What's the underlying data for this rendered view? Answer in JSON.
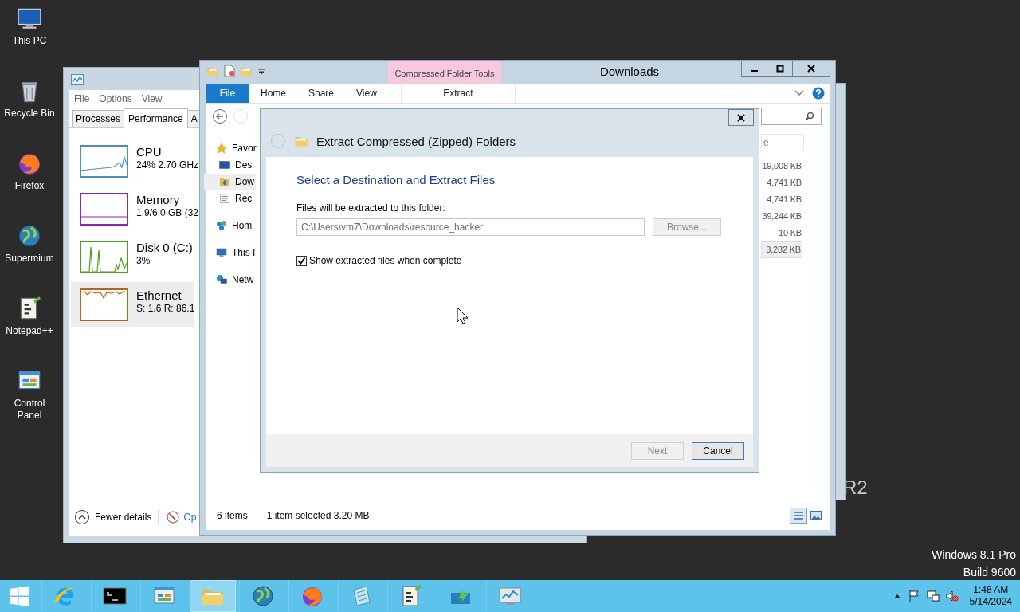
{
  "desktop_icons": [
    {
      "kind": "pc",
      "label": "This PC"
    },
    {
      "kind": "bin",
      "label": "Recycle Bin"
    },
    {
      "kind": "firefox",
      "label": "Firefox"
    },
    {
      "kind": "globe",
      "label": "Supermium"
    },
    {
      "kind": "notepadpp",
      "label": "Notepad++"
    },
    {
      "kind": "panel",
      "label": "Control Panel"
    }
  ],
  "desktop_text": {
    "edition_fragment": "R2",
    "edition": "Windows 8.1 Pro",
    "build": "Build 9600"
  },
  "task_manager": {
    "menu": [
      "File",
      "Options",
      "View"
    ],
    "tabs": [
      {
        "label": "Processes",
        "selected": false
      },
      {
        "label": "Performance",
        "selected": true
      },
      {
        "label": "A",
        "selected": false
      }
    ],
    "resources": [
      {
        "name": "CPU",
        "detail": "24%  2.70 GHz",
        "color": "#4a8fc0",
        "selected": false
      },
      {
        "name": "Memory",
        "detail": "1.9/6.0 GB (32",
        "color": "#8b28a8",
        "selected": false
      },
      {
        "name": "Disk 0 (C:)",
        "detail": "3%",
        "color": "#4da11a",
        "selected": false
      },
      {
        "name": "Ethernet",
        "detail": "S: 1.6  R: 86.1",
        "color": "#b8651c",
        "selected": true
      }
    ],
    "fewer_details": "Fewer details",
    "link": "Op"
  },
  "explorer": {
    "title": "Downloads",
    "context_group": "Compressed Folder Tools",
    "ribbon_tabs": [
      {
        "label": "File",
        "kind": "file",
        "selected": false
      },
      {
        "label": "Home",
        "kind": "tab",
        "selected": false
      },
      {
        "label": "Share",
        "kind": "tab",
        "selected": false
      },
      {
        "label": "View",
        "kind": "tab",
        "selected": false
      },
      {
        "label": "Extract",
        "kind": "context",
        "selected": false
      }
    ],
    "nav_items": [
      {
        "label": "Favor",
        "kind": "star",
        "selected": false,
        "children": [
          {
            "label": "Des",
            "kind": "desktop",
            "selected": false
          },
          {
            "label": "Dow",
            "kind": "downloads",
            "selected": true
          },
          {
            "label": "Rec",
            "kind": "recent",
            "selected": false
          }
        ]
      },
      {
        "label": "Hom",
        "kind": "homegroup",
        "selected": false
      },
      {
        "label": "This I",
        "kind": "pc",
        "selected": false
      },
      {
        "label": "Netw",
        "kind": "network",
        "selected": false
      }
    ],
    "column_header": "e",
    "sizes": [
      {
        "text": "19,008 KB",
        "selected": false
      },
      {
        "text": "4,741 KB",
        "selected": false
      },
      {
        "text": "4,741 KB",
        "selected": false
      },
      {
        "text": "39,244 KB",
        "selected": false
      },
      {
        "text": "10 KB",
        "selected": false
      },
      {
        "text": "3,282 KB",
        "selected": true
      }
    ],
    "status": {
      "items": "6 items",
      "selection": "1 item selected  3.20 MB"
    }
  },
  "dialog": {
    "title": "Extract Compressed (Zipped) Folders",
    "heading": "Select a Destination and Extract Files",
    "field_label": "Files will be extracted to this folder:",
    "path": "C:\\Users\\vm7\\Downloads\\resource_hacker",
    "browse": {
      "label": "Browse...",
      "disabled": true
    },
    "checkbox": {
      "label": "Show extracted files when complete",
      "checked": true
    },
    "buttons": [
      {
        "label": "Next",
        "disabled": true
      },
      {
        "label": "Cancel",
        "disabled": false
      }
    ]
  },
  "taskbar": {
    "apps": [
      {
        "kind": "ie",
        "selected": false
      },
      {
        "kind": "cmd",
        "selected": false
      },
      {
        "kind": "panel",
        "selected": false
      },
      {
        "kind": "folder",
        "selected": true
      },
      {
        "kind": "globe",
        "selected": false
      },
      {
        "kind": "firefox",
        "selected": false
      },
      {
        "kind": "notepad",
        "selected": false
      },
      {
        "kind": "notepadpp",
        "selected": false
      },
      {
        "kind": "arrow",
        "selected": false
      },
      {
        "kind": "monitor",
        "selected": false
      }
    ],
    "clock": {
      "time": "1:48 AM",
      "date": "5/14/2024"
    }
  }
}
